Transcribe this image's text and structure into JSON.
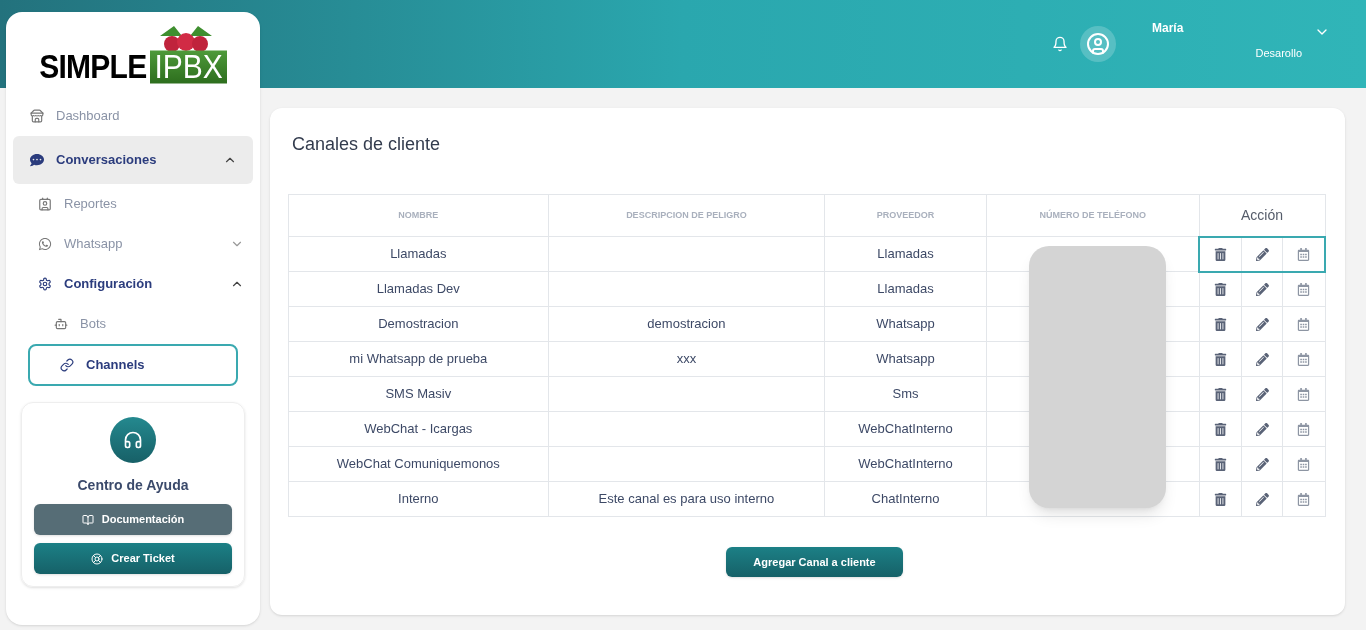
{
  "logo": {
    "word_1": "SIMPLE",
    "word_2": "IPBX"
  },
  "sidebar": {
    "items": [
      {
        "label": "Dashboard",
        "kind": "store",
        "selected": false
      },
      {
        "label": "Conversaciones",
        "kind": "chat",
        "selected": false,
        "expanded": true,
        "children": [
          {
            "label": "Reportes",
            "kind": "contact",
            "selected": false
          },
          {
            "label": "Whatsapp",
            "kind": "whatsapp",
            "selected": false,
            "expanded": false
          },
          {
            "label": "Configuración",
            "kind": "gear",
            "selected": false,
            "expanded": true,
            "children": [
              {
                "label": "Bots",
                "kind": "robot",
                "selected": false
              },
              {
                "label": "Channels",
                "kind": "link",
                "selected": true
              }
            ]
          }
        ]
      }
    ]
  },
  "help": {
    "title": "Centro de Ayuda",
    "buttons": [
      {
        "label": "Documentación",
        "kind": "docs"
      },
      {
        "label": "Crear Ticket",
        "kind": "ticket"
      }
    ]
  },
  "header": {
    "user_name": "María",
    "user_role": "Desarollo"
  },
  "page": {
    "title": "Canales de cliente",
    "table": {
      "columns": [
        "NOMBRE",
        "DESCRIPCION DE PELIGRO",
        "PROVEEDOR",
        "NÚMERO DE TELÉFONO"
      ],
      "action_column": "Acción",
      "rows": [
        {
          "nombre": "Llamadas",
          "descripcion": "",
          "proveedor": "Llamadas",
          "highlighted": true
        },
        {
          "nombre": "Llamadas Dev",
          "descripcion": "",
          "proveedor": "Llamadas",
          "highlighted": false
        },
        {
          "nombre": "Demostracion",
          "descripcion": "demostracion",
          "proveedor": "Whatsapp",
          "highlighted": false
        },
        {
          "nombre": "mi Whatsapp de prueba",
          "descripcion": "xxx",
          "proveedor": "Whatsapp",
          "highlighted": false
        },
        {
          "nombre": "SMS Masiv",
          "descripcion": "",
          "proveedor": "Sms",
          "highlighted": false
        },
        {
          "nombre": "WebChat - Icargas",
          "descripcion": "",
          "proveedor": "WebChatInterno",
          "highlighted": false
        },
        {
          "nombre": "WebChat Comuniquemonos",
          "descripcion": "",
          "proveedor": "WebChatInterno",
          "highlighted": false
        },
        {
          "nombre": "Interno",
          "descripcion": "Este canal es para uso interno",
          "proveedor": "ChatInterno",
          "highlighted": false
        }
      ]
    },
    "add_button": "Agregar Canal a cliente"
  }
}
